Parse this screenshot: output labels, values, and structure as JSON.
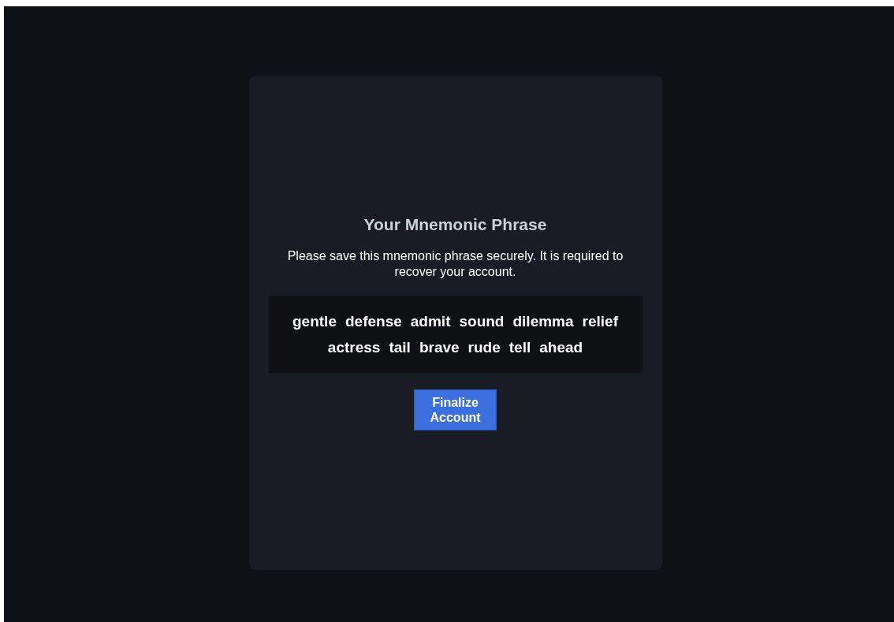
{
  "card": {
    "title": "Your Mnemonic Phrase",
    "message": "Please save this mnemonic phrase securely. It is required to recover your account.",
    "words": [
      "gentle",
      "defense",
      "admit",
      "sound",
      "dilemma",
      "relief",
      "actress",
      "tail",
      "brave",
      "rude",
      "tell",
      "ahead"
    ],
    "button": "Finalize Account"
  }
}
